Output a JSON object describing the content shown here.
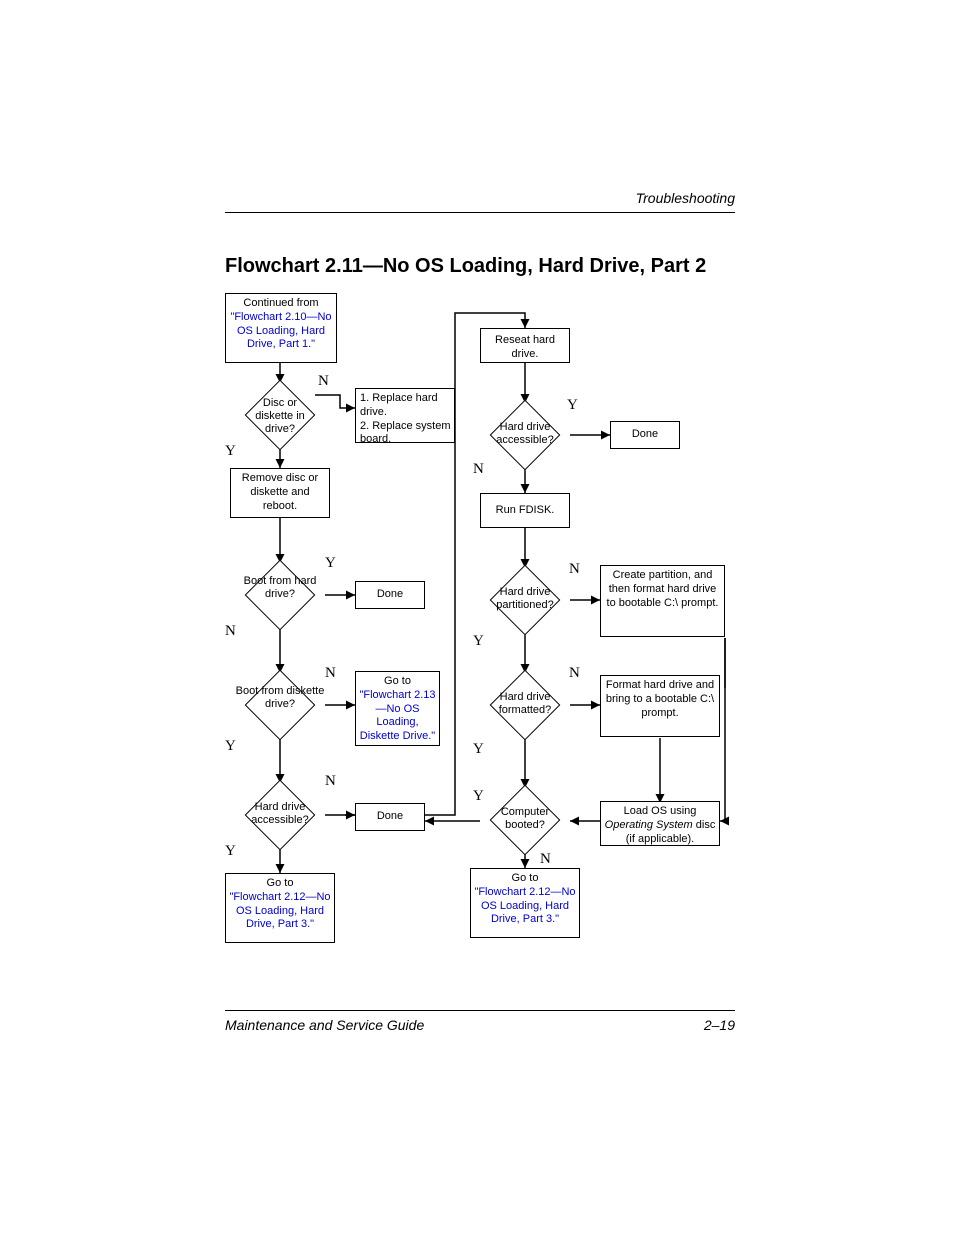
{
  "header": {
    "section": "Troubleshooting"
  },
  "title": "Flowchart 2.11—No OS Loading, Hard Drive, Part 2",
  "footer": {
    "left": "Maintenance and Service Guide",
    "right": "2–19"
  },
  "nodes": {
    "continued_prefix": "Continued from",
    "continued_link": "\"Flowchart 2.10—No OS Loading, Hard Drive, Part 1.\"",
    "disc_in_drive": "Disc or diskette in drive?",
    "replace_steps": "1. Replace hard drive.\n2. Replace system board.",
    "remove_disc": "Remove disc or diskette and reboot.",
    "boot_hd": "Boot from hard drive?",
    "done": "Done",
    "boot_diskette": "Boot from diskette drive?",
    "goto_213_prefix": "Go to",
    "goto_213_link": "\"Flowchart 2.13—No OS Loading, Diskette Drive.\"",
    "hd_accessible": "Hard drive accessible?",
    "goto_212_prefix": "Go to",
    "goto_212_link": "\"Flowchart 2.12—No OS Loading, Hard Drive, Part 3.\"",
    "reseat": "Reseat hard drive.",
    "hd_accessible2": "Hard drive accessible?",
    "run_fdisk": "Run FDISK.",
    "hd_partitioned": "Hard drive partitioned?",
    "create_partition": "Create partition, and then format hard drive to bootable C:\\ prompt.",
    "hd_formatted": "Hard drive formatted?",
    "format_hd": "Format hard drive and bring to a bootable C:\\ prompt.",
    "computer_booted": "Computer booted?",
    "load_os_a": "Load OS using ",
    "load_os_i": "Operating System",
    "load_os_b": " disc (if applicable)."
  },
  "labels": {
    "Y": "Y",
    "N": "N"
  },
  "chart_data": {
    "type": "flowchart",
    "title": "Flowchart 2.11—No OS Loading, Hard Drive, Part 2",
    "nodes": [
      {
        "id": "A",
        "type": "start",
        "text": "Continued from \"Flowchart 2.10—No OS Loading, Hard Drive, Part 1.\""
      },
      {
        "id": "B",
        "type": "decision",
        "text": "Disc or diskette in drive?"
      },
      {
        "id": "C",
        "type": "process",
        "text": "1. Replace hard drive. 2. Replace system board."
      },
      {
        "id": "D",
        "type": "process",
        "text": "Remove disc or diskette and reboot."
      },
      {
        "id": "E",
        "type": "decision",
        "text": "Boot from hard drive?"
      },
      {
        "id": "F",
        "type": "terminal",
        "text": "Done"
      },
      {
        "id": "G",
        "type": "decision",
        "text": "Boot from diskette drive?"
      },
      {
        "id": "H",
        "type": "reference",
        "text": "Go to \"Flowchart 2.13—No OS Loading, Diskette Drive.\""
      },
      {
        "id": "I",
        "type": "decision",
        "text": "Hard drive accessible?"
      },
      {
        "id": "J",
        "type": "terminal",
        "text": "Done"
      },
      {
        "id": "K",
        "type": "reference",
        "text": "Go to \"Flowchart 2.12—No OS Loading, Hard Drive, Part 3.\""
      },
      {
        "id": "L",
        "type": "process",
        "text": "Reseat hard drive."
      },
      {
        "id": "M",
        "type": "decision",
        "text": "Hard drive accessible?"
      },
      {
        "id": "N",
        "type": "terminal",
        "text": "Done"
      },
      {
        "id": "O",
        "type": "process",
        "text": "Run FDISK."
      },
      {
        "id": "P",
        "type": "decision",
        "text": "Hard drive partitioned?"
      },
      {
        "id": "Q",
        "type": "process",
        "text": "Create partition, and then format hard drive to bootable C:\\ prompt."
      },
      {
        "id": "R",
        "type": "decision",
        "text": "Hard drive formatted?"
      },
      {
        "id": "S",
        "type": "process",
        "text": "Format hard drive and bring to a bootable C:\\ prompt."
      },
      {
        "id": "T",
        "type": "decision",
        "text": "Computer booted?"
      },
      {
        "id": "U",
        "type": "process",
        "text": "Load OS using Operating System disc (if applicable)."
      },
      {
        "id": "V",
        "type": "reference",
        "text": "Go to \"Flowchart 2.12—No OS Loading, Hard Drive, Part 3.\""
      }
    ],
    "edges": [
      {
        "from": "A",
        "to": "B"
      },
      {
        "from": "B",
        "to": "D",
        "label": "Y"
      },
      {
        "from": "B",
        "to": "C",
        "label": "N"
      },
      {
        "from": "D",
        "to": "E"
      },
      {
        "from": "E",
        "to": "F",
        "label": "Y"
      },
      {
        "from": "E",
        "to": "G",
        "label": "N"
      },
      {
        "from": "G",
        "to": "I",
        "label": "Y"
      },
      {
        "from": "G",
        "to": "H",
        "label": "N"
      },
      {
        "from": "I",
        "to": "K",
        "label": "Y"
      },
      {
        "from": "I",
        "to": "J",
        "label": "N"
      },
      {
        "from": "I",
        "to": "L",
        "label": "N",
        "note": "via right column"
      },
      {
        "from": "L",
        "to": "M"
      },
      {
        "from": "M",
        "to": "N",
        "label": "Y"
      },
      {
        "from": "M",
        "to": "O",
        "label": "N"
      },
      {
        "from": "O",
        "to": "P"
      },
      {
        "from": "P",
        "to": "R",
        "label": "Y"
      },
      {
        "from": "P",
        "to": "Q",
        "label": "N"
      },
      {
        "from": "R",
        "to": "T",
        "label": "Y"
      },
      {
        "from": "R",
        "to": "S",
        "label": "N"
      },
      {
        "from": "Q",
        "to": "U"
      },
      {
        "from": "S",
        "to": "U"
      },
      {
        "from": "U",
        "to": "T"
      },
      {
        "from": "T",
        "to": "J",
        "label": "Y"
      },
      {
        "from": "T",
        "to": "V",
        "label": "N"
      }
    ]
  }
}
